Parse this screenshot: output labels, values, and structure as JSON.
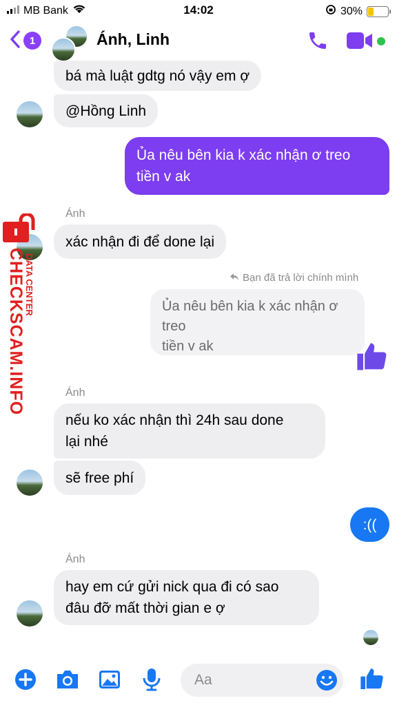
{
  "status_bar": {
    "carrier": "MB Bank",
    "time": "14:02",
    "battery": "30%",
    "battery_level": 0.3
  },
  "header": {
    "unread_count": "1",
    "title": "Ánh, Linh"
  },
  "colors": {
    "accent": "#7d3df0",
    "blue": "#1877f2",
    "incoming": "#eeeef0",
    "online": "#31c24d"
  },
  "messages": {
    "m1": "bá mà luật gdtg nó vậy em ợ",
    "m2": "@Hồng Linh",
    "m3_line1": "Ủa nêu bên kia k xác nhận ơ treo",
    "m3_line2": "tiền v ak",
    "sender_anh_1": "Ánh",
    "m4": "xác nhận đi để done lại",
    "reply_label": "Bạn đã trả lời chính mình",
    "quote_line1": "Ủa nêu bên kia k xác nhận ơ treo",
    "quote_line2": "tiền v ak",
    "sender_anh_2": "Ánh",
    "m5_line1": "nếu ko xác nhận thì 24h sau done",
    "m5_line2": "lại nhé",
    "m6": "sẽ free phí",
    "m7": ":((",
    "sender_anh_3": "Ánh",
    "m8_line1": "hay em cứ gửi nick qua đi có sao",
    "m8_line2": "đâu đỡ mất thời gian e ợ"
  },
  "composer": {
    "placeholder": "Aa"
  },
  "watermark": {
    "main": "CHECKSCAM.INFO",
    "sub": "DATA CENTER"
  },
  "icons": [
    "back-chevron-icon",
    "phone-icon",
    "video-icon",
    "plus-icon",
    "camera-icon",
    "gallery-icon",
    "mic-icon",
    "emoji-icon",
    "like-icon",
    "reply-arrow-icon",
    "lock-icon",
    "wifi-icon"
  ]
}
